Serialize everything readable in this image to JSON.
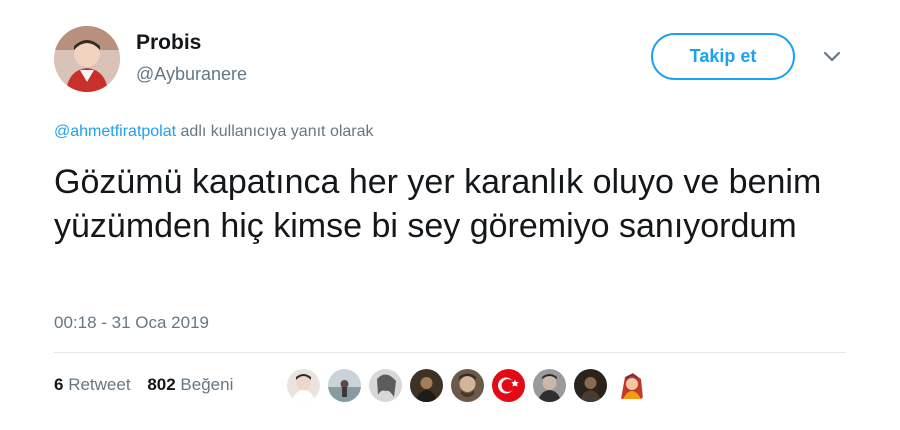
{
  "user": {
    "display_name": "Probis",
    "handle": "@Ayburanere"
  },
  "follow_label": "Takip et",
  "reply": {
    "mention": "@ahmetfiratpolat",
    "suffix": " adlı kullanıcıya yanıt olarak"
  },
  "tweet": {
    "text": "Gözümü kapatınca her yer karanlık oluyo ve benim yüzümden hiç kimse bi sey göremiyo sanıyordum",
    "timestamp": "00:18 - 31 Oca 2019"
  },
  "stats": {
    "retweets": "6",
    "retweets_label": "Retweet",
    "likes": "802",
    "likes_label": "Beğeni"
  },
  "icons": {
    "caret": "chevron-down-icon"
  },
  "colors": {
    "accent": "#1da1f2",
    "secondary_text": "#657786",
    "divider": "#e1e8ed"
  }
}
